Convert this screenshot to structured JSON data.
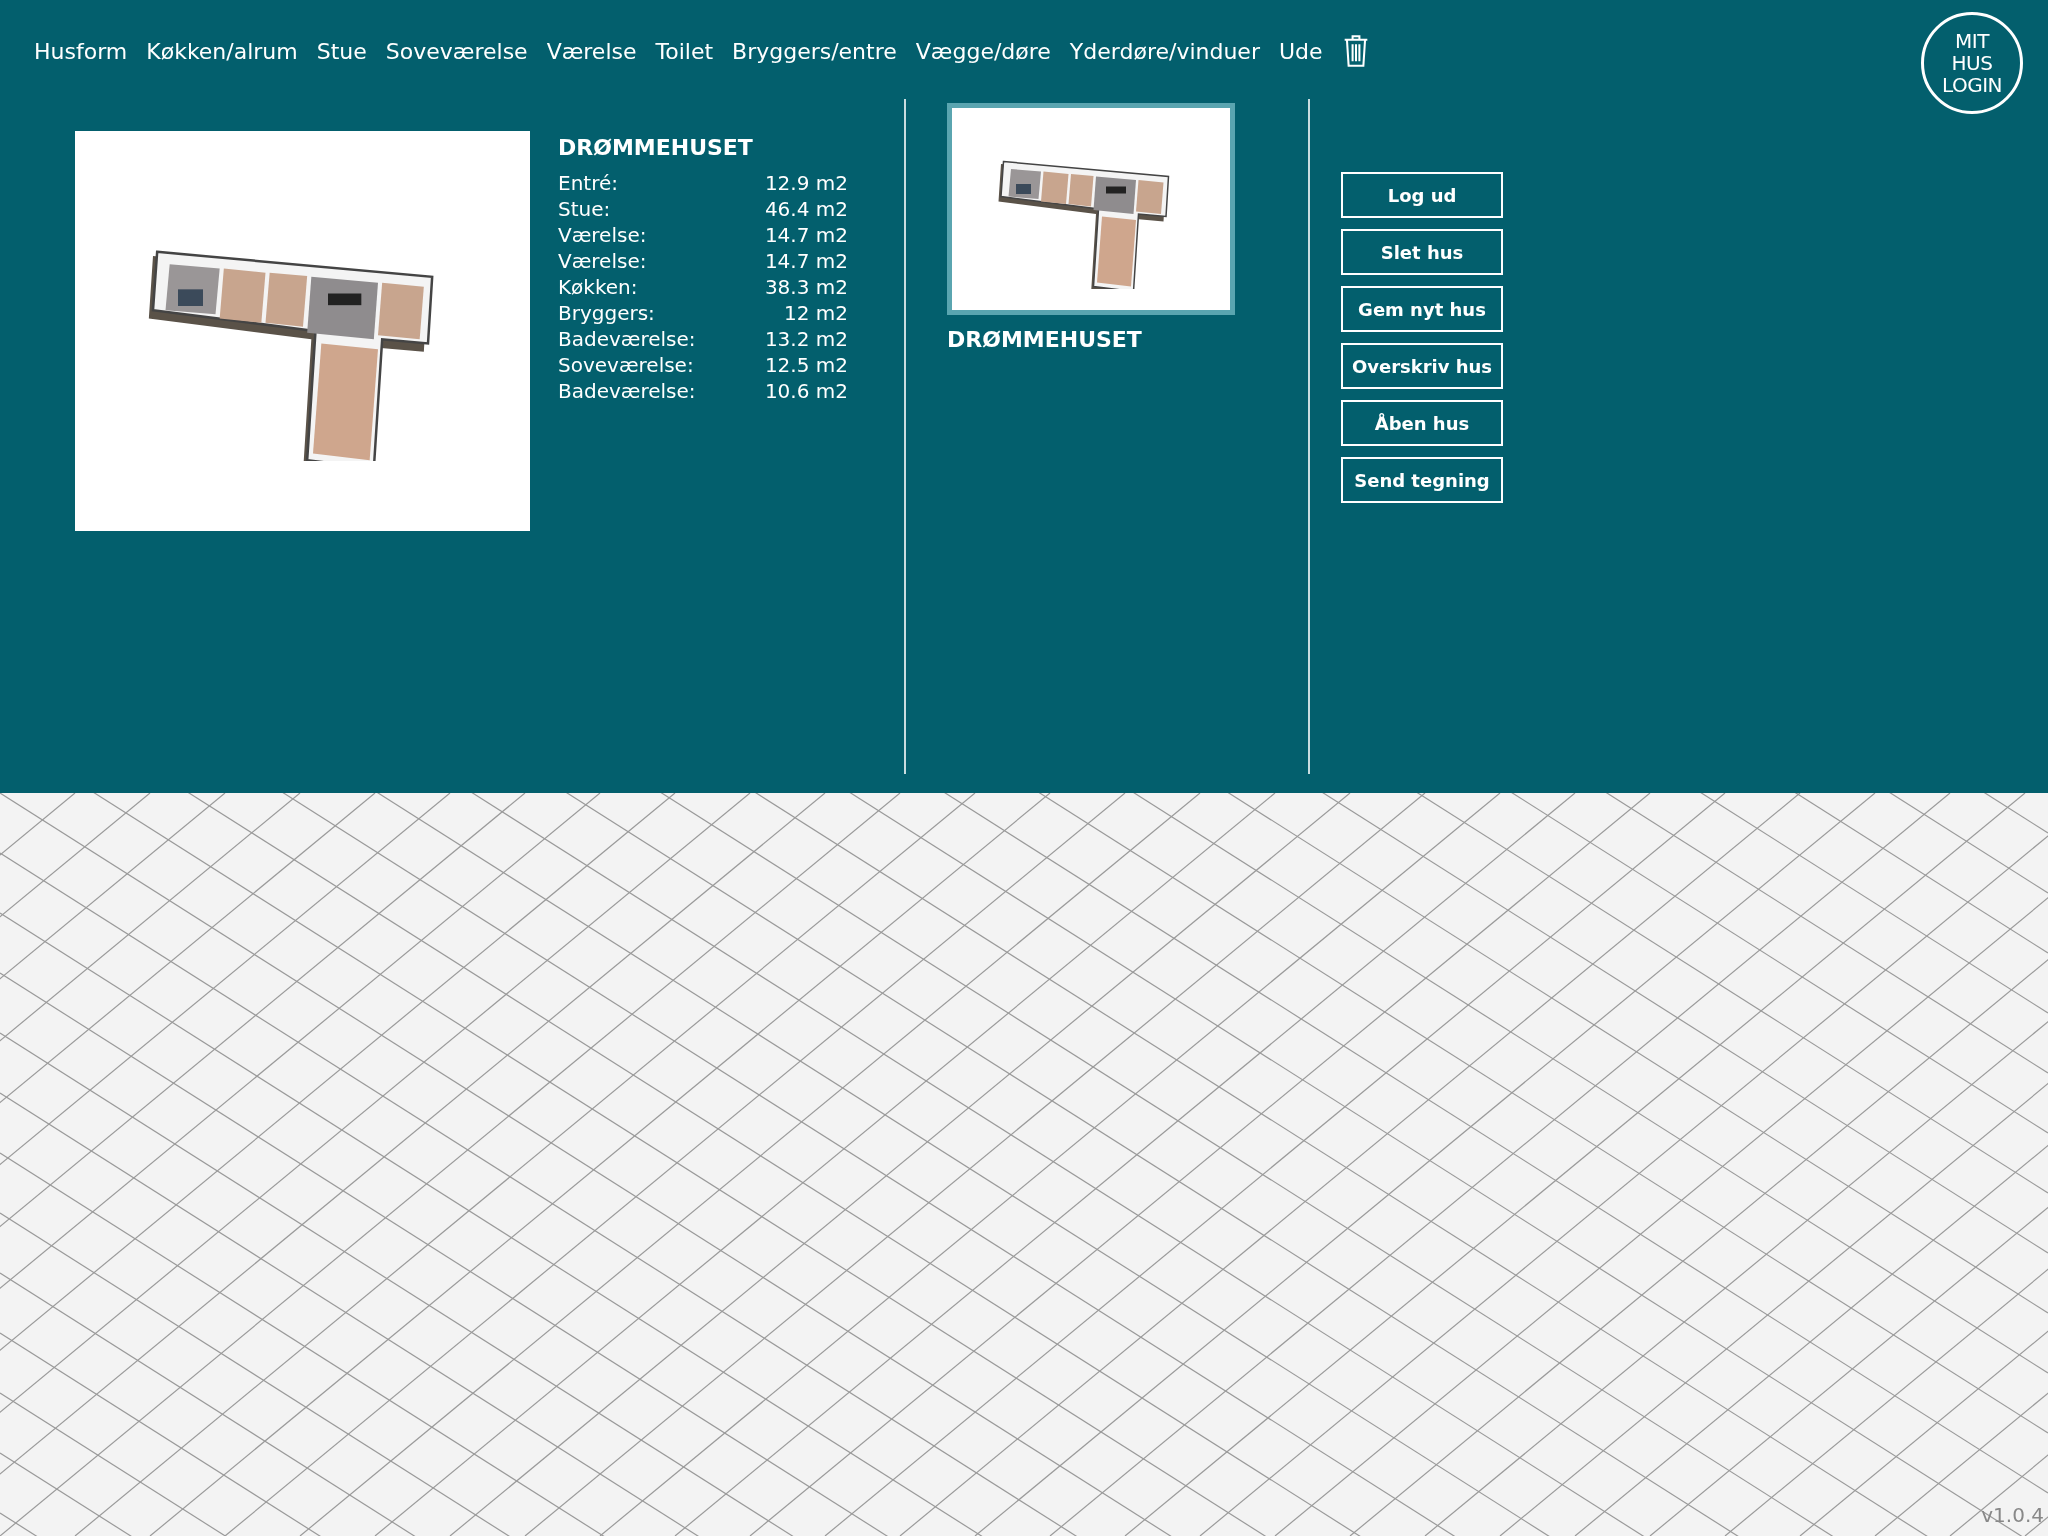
{
  "nav": {
    "items": [
      {
        "label": "Husform"
      },
      {
        "label": "Køkken/alrum"
      },
      {
        "label": "Stue"
      },
      {
        "label": "Soveværelse"
      },
      {
        "label": "Værelse"
      },
      {
        "label": "Toilet"
      },
      {
        "label": "Bryggers/entre"
      },
      {
        "label": "Vægge/døre"
      },
      {
        "label": "Yderdøre/vinduer"
      },
      {
        "label": "Ude"
      }
    ]
  },
  "logo": {
    "lines": [
      "MIT",
      "HUS",
      "LOGIN"
    ]
  },
  "current_house": {
    "title": "DRØMMEHUSET",
    "rooms": [
      {
        "name": "Entré:",
        "area": "12.9 m2"
      },
      {
        "name": "Stue:",
        "area": "46.4 m2"
      },
      {
        "name": "Værelse:",
        "area": "14.7 m2"
      },
      {
        "name": "Værelse:",
        "area": "14.7 m2"
      },
      {
        "name": "Køkken:",
        "area": "38.3 m2"
      },
      {
        "name": "Bryggers:",
        "area": "12 m2"
      },
      {
        "name": "Badeværelse:",
        "area": "13.2 m2"
      },
      {
        "name": "Soveværelse:",
        "area": "12.5 m2"
      },
      {
        "name": "Badeværelse:",
        "area": "10.6 m2"
      }
    ]
  },
  "saved_houses": [
    {
      "title": "DRØMMEHUSET",
      "selected": true
    }
  ],
  "actions": [
    "Log ud",
    "Slet hus",
    "Gem nyt hus",
    "Overskriv hus",
    "Åben hus",
    "Send tegning"
  ],
  "version": "v1.0.4"
}
